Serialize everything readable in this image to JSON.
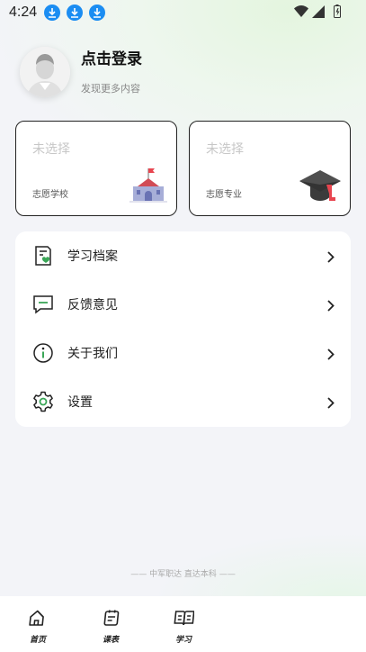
{
  "status_bar": {
    "time": "4:24",
    "download_count": 3
  },
  "profile": {
    "title": "点击登录",
    "subtitle": "发现更多内容"
  },
  "cards": [
    {
      "value": "未选择",
      "label": "志愿学校",
      "icon": "school-building-icon"
    },
    {
      "value": "未选择",
      "label": "志愿专业",
      "icon": "graduation-cap-icon"
    }
  ],
  "menu": {
    "items": [
      {
        "label": "学习档案",
        "icon": "study-file-icon"
      },
      {
        "label": "反馈意见",
        "icon": "feedback-icon"
      },
      {
        "label": "关于我们",
        "icon": "info-icon"
      },
      {
        "label": "设置",
        "icon": "gear-icon"
      }
    ]
  },
  "footer": {
    "slogan": "中军职达 直达本科"
  },
  "tabbar": {
    "tabs": [
      {
        "label": "首页",
        "icon": "home-icon"
      },
      {
        "label": "课表",
        "icon": "schedule-icon"
      },
      {
        "label": "学习",
        "icon": "book-icon"
      }
    ]
  },
  "colors": {
    "accent_green": "#3aa657",
    "download_blue": "#1b8df2",
    "background": "#f3f4f8"
  }
}
